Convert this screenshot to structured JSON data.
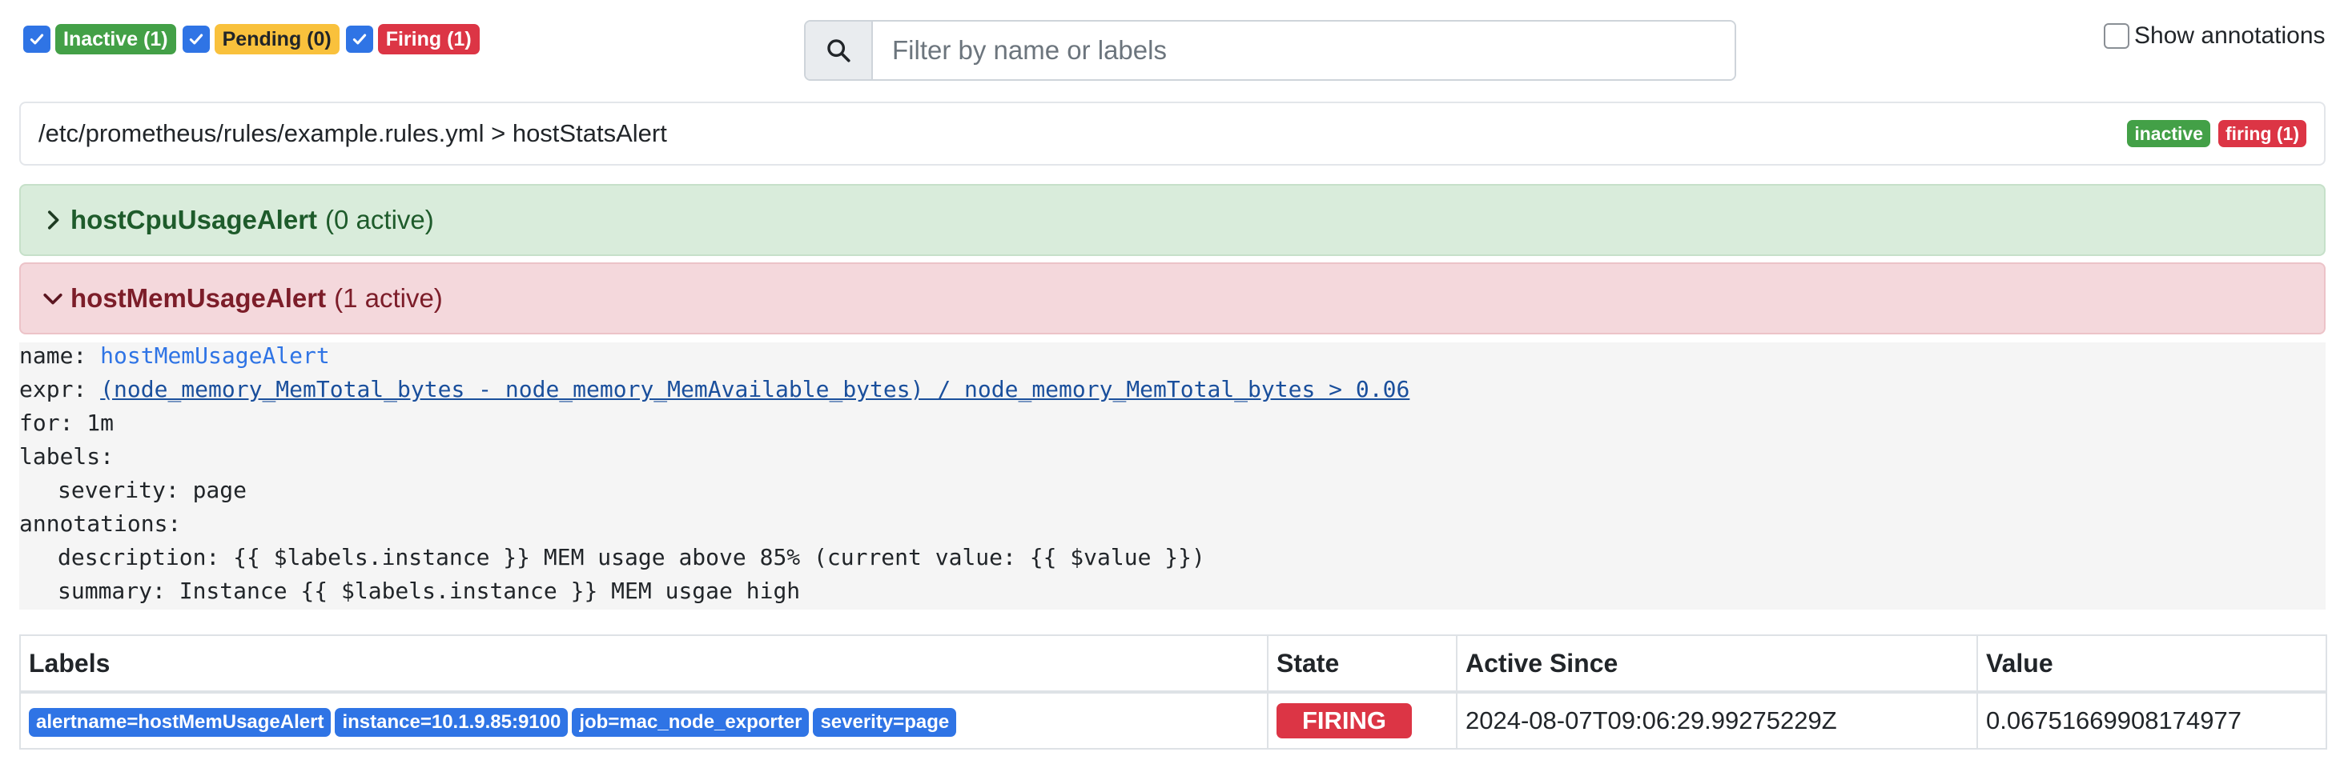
{
  "filters": [
    {
      "label": "Inactive (1)",
      "checked": true,
      "color": "#43a047"
    },
    {
      "label": "Pending (0)",
      "checked": true,
      "color": "#f9c13c"
    },
    {
      "label": "Firing (1)",
      "checked": true,
      "color": "#dc3545"
    }
  ],
  "search": {
    "placeholder": "Filter by name or labels",
    "value": ""
  },
  "show_annotations": {
    "label": "Show annotations",
    "checked": false
  },
  "group": {
    "title": "/etc/prometheus/rules/example.rules.yml > hostStatsAlert",
    "badges": [
      {
        "label": "inactive",
        "color": "#43a047"
      },
      {
        "label": "firing (1)",
        "color": "#dc3545"
      }
    ]
  },
  "rules": [
    {
      "name": "hostCpuUsageAlert",
      "count": "(0 active)",
      "state": "inactive",
      "expanded": false
    },
    {
      "name": "hostMemUsageAlert",
      "count": "(1 active)",
      "state": "firing",
      "expanded": true
    }
  ],
  "definition": {
    "name_key": "name:",
    "name_value": "hostMemUsageAlert",
    "expr_key": "expr:",
    "expr_value": "(node_memory_MemTotal_bytes - node_memory_MemAvailable_bytes) / node_memory_MemTotal_bytes > 0.06",
    "for_line": "for: 1m",
    "labels_key": "labels:",
    "severity_line": "severity: page",
    "annotations_key": "annotations:",
    "description_line": "description: {{ $labels.instance }} MEM usage above 85% (current value: {{ $value }})",
    "summary_line": "summary: Instance {{ $labels.instance }} MEM usgae high"
  },
  "table": {
    "headers": [
      "Labels",
      "State",
      "Active Since",
      "Value"
    ],
    "row": {
      "labels": [
        "alertname=hostMemUsageAlert",
        "instance=10.1.9.85:9100",
        "job=mac_node_exporter",
        "severity=page"
      ],
      "state": "FIRING",
      "active_since": "2024-08-07T09:06:29.99275229Z",
      "value": "0.06751669908174977"
    }
  }
}
